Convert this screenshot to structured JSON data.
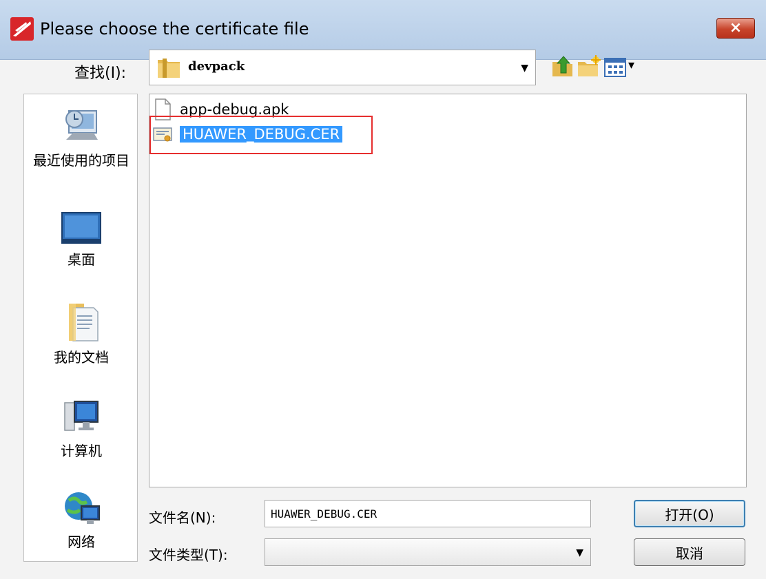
{
  "window": {
    "title": "Please choose the certificate file",
    "close_symbol": "×"
  },
  "look_in": {
    "label": "查找(I):",
    "value": "devpack",
    "arrow": "▼"
  },
  "toolbar": {
    "icons": [
      "up-folder-icon",
      "new-folder-icon",
      "view-menu-icon"
    ],
    "view_arrow": "▾"
  },
  "places": [
    {
      "label": "最近使用的项目",
      "icon": "recent-items-icon"
    },
    {
      "label": "桌面",
      "icon": "desktop-icon"
    },
    {
      "label": "我的文档",
      "icon": "documents-icon"
    },
    {
      "label": "计算机",
      "icon": "computer-icon"
    },
    {
      "label": "网络",
      "icon": "network-icon"
    }
  ],
  "files": [
    {
      "name": "app-debug.apk",
      "icon": "file-icon",
      "selected": false
    },
    {
      "name": "HUAWER_DEBUG.CER",
      "icon": "certificate-icon",
      "selected": true
    }
  ],
  "file_name": {
    "label": "文件名(N):",
    "value": "HUAWER_DEBUG.CER"
  },
  "file_type": {
    "label": "文件类型(T):",
    "value": "",
    "arrow": "▼"
  },
  "buttons": {
    "open": "打开(O)",
    "cancel": "取消"
  },
  "colors": {
    "selection": "#3399ff",
    "highlight_box": "#e62e2e",
    "titlebar": "#c9dbef"
  }
}
